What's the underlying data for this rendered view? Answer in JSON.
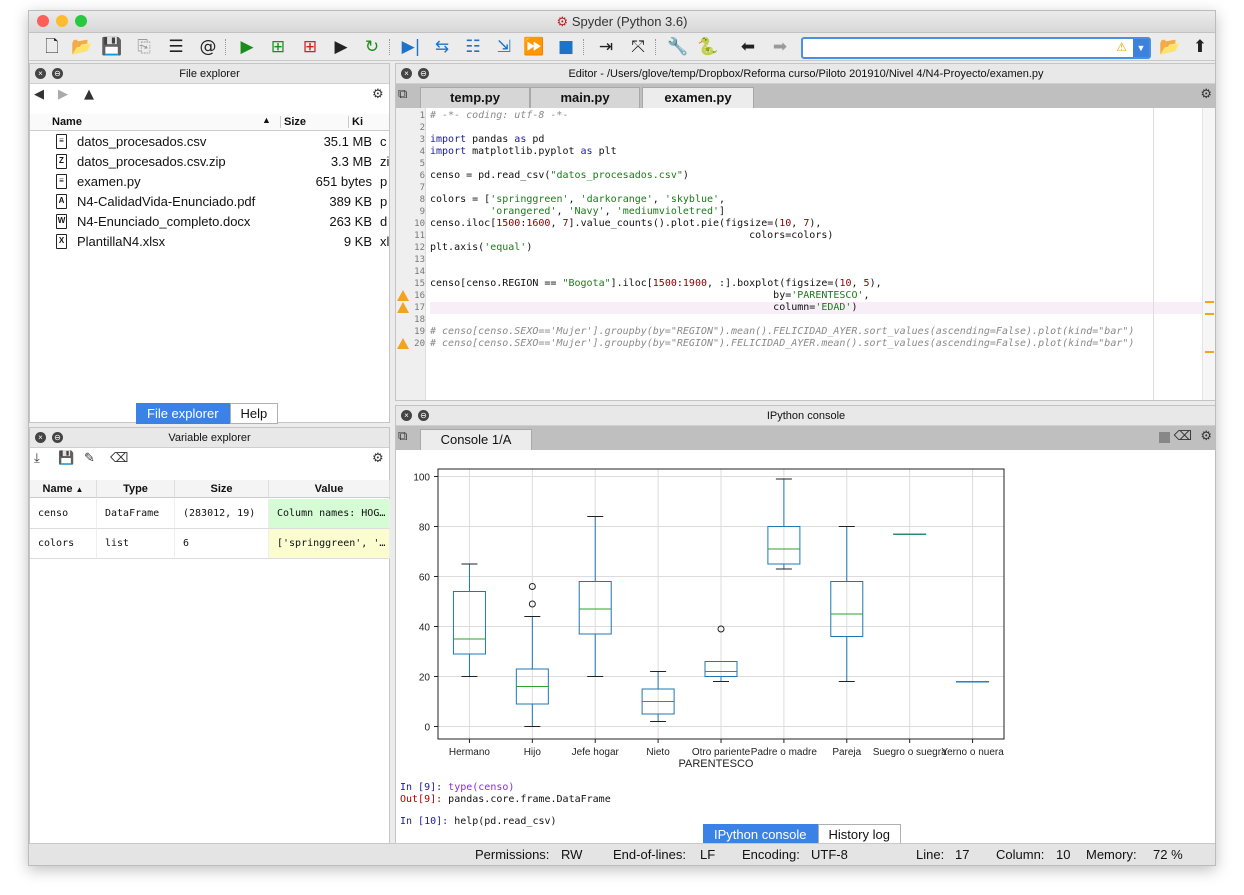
{
  "window": {
    "title": "Spyder (Python 3.6)"
  },
  "toolbar": {
    "search_value": ""
  },
  "file_explorer": {
    "title": "File explorer",
    "col_name": "Name",
    "col_size": "Size",
    "col_kind": "Ki",
    "files": [
      {
        "name": "datos_procesados.csv",
        "size": "35.1 MB",
        "kind": "c",
        "icon": "text-file-icon"
      },
      {
        "name": "datos_procesados.csv.zip",
        "size": "3.3 MB",
        "kind": "zi",
        "icon": "zip-file-icon"
      },
      {
        "name": "examen.py",
        "size": "651 bytes",
        "kind": "p",
        "icon": "text-file-icon"
      },
      {
        "name": "N4-CalidadVida-Enunciado.pdf",
        "size": "389 KB",
        "kind": "p",
        "icon": "pdf-file-icon"
      },
      {
        "name": "N4-Enunciado_completo.docx",
        "size": "263 KB",
        "kind": "d",
        "icon": "word-file-icon"
      },
      {
        "name": "PlantillaN4.xlsx",
        "size": "9 KB",
        "kind": "xl",
        "icon": "excel-file-icon"
      }
    ],
    "tabs": [
      "File explorer",
      "Help"
    ]
  },
  "variable_explorer": {
    "title": "Variable explorer",
    "cols": [
      "Name",
      "Type",
      "Size",
      "Value"
    ],
    "rows": [
      {
        "name": "censo",
        "type": "DataFrame",
        "size": "(283012, 19)",
        "value": "Column names: HOG…"
      },
      {
        "name": "colors",
        "type": "list",
        "size": "6",
        "value": "['springgreen', '…"
      }
    ]
  },
  "editor": {
    "title": "Editor - /Users/glove/temp/Dropbox/Reforma curso/Piloto 201910/Nivel 4/N4-Proyecto/examen.py",
    "tabs": [
      "temp.py",
      "main.py",
      "examen.py"
    ],
    "active_tab": "examen.py"
  },
  "console": {
    "title": "IPython console",
    "tab": "Console 1/A",
    "lines": [
      {
        "prompt": "In [9]: ",
        "code": "type(censo)"
      },
      {
        "prompt": "Out[9]: ",
        "code": "pandas.core.frame.DataFrame"
      },
      {
        "prompt": "In [10]: ",
        "code": "help(pd.read_csv)"
      }
    ],
    "tabs": [
      "IPython console",
      "History log"
    ]
  },
  "status": {
    "permissions": "Permissions:",
    "permissions_val": "RW",
    "eol": "End-of-lines:",
    "eol_val": "LF",
    "enc": "Encoding:",
    "enc_val": "UTF-8",
    "line": "Line:",
    "line_val": "17",
    "col": "Column:",
    "col_val": "10",
    "mem": "Memory:",
    "mem_val": "72 %"
  },
  "chart_data": {
    "type": "boxplot",
    "xlabel": "PARENTESCO",
    "ylim": [
      -5,
      103
    ],
    "yticks": [
      0,
      20,
      40,
      60,
      80,
      100
    ],
    "categories": [
      "Hermano",
      "Hijo",
      "Jefe hogar",
      "Nieto",
      "Otro pariente",
      "Padre o madre",
      "Pareja",
      "Suegro o suegra",
      "Yerno o nuera"
    ],
    "boxes": [
      {
        "min": 20,
        "q1": 29,
        "median": 35,
        "q3": 54,
        "max": 65,
        "outliers": []
      },
      {
        "min": 0,
        "q1": 9,
        "median": 16,
        "q3": 23,
        "max": 44,
        "outliers": [
          49,
          56
        ]
      },
      {
        "min": 20,
        "q1": 37,
        "median": 47,
        "q3": 58,
        "max": 84,
        "outliers": []
      },
      {
        "min": 2,
        "q1": 5,
        "median": 10,
        "q3": 15,
        "max": 22,
        "outliers": []
      },
      {
        "min": 18,
        "q1": 20,
        "median": 22,
        "q3": 26,
        "max": 26,
        "outliers": [
          39
        ]
      },
      {
        "min": 63,
        "q1": 65,
        "median": 71,
        "q3": 80,
        "max": 99,
        "outliers": []
      },
      {
        "min": 18,
        "q1": 36,
        "median": 45,
        "q3": 58,
        "max": 80,
        "outliers": []
      },
      {
        "min": 77,
        "q1": 77,
        "median": 77,
        "q3": 77,
        "max": 77,
        "outliers": []
      },
      {
        "min": 18,
        "q1": 18,
        "median": 18,
        "q3": 18,
        "max": 18,
        "outliers": []
      }
    ],
    "grid": true,
    "box_color": "#1f77b4",
    "median_color": "#2ca02c"
  }
}
